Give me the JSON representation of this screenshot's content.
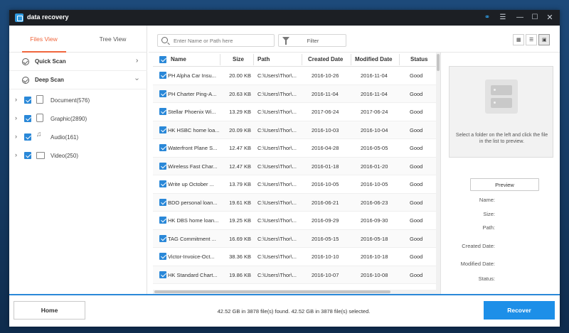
{
  "app": {
    "title": "data recovery"
  },
  "view_tabs": [
    {
      "label": "Files View"
    },
    {
      "label": "Tree View"
    }
  ],
  "scans": [
    {
      "label": "Quick Scan"
    },
    {
      "label": "Deep Scan"
    }
  ],
  "tree": [
    {
      "label": "Document(576)"
    },
    {
      "label": "Graphic(2890)"
    },
    {
      "label": "Audio(161)"
    },
    {
      "label": "Video(250)"
    }
  ],
  "search": {
    "placeholder": "Enter Name or Path here"
  },
  "filter": {
    "label": "Filter"
  },
  "columns": {
    "name": "Name",
    "size": "Size",
    "path": "Path",
    "created": "Created Date",
    "modified": "Modified Date",
    "status": "Status"
  },
  "rows": [
    {
      "name": "PH Alpha Car Insu...",
      "size": "20.00 KB",
      "path": "C:\\Users\\Thor\\...",
      "created": "2016-10-26",
      "modified": "2016-11-04",
      "status": "Good"
    },
    {
      "name": "PH Charter Ping-A...",
      "size": "20.63 KB",
      "path": "C:\\Users\\Thor\\...",
      "created": "2016-11-04",
      "modified": "2016-11-04",
      "status": "Good"
    },
    {
      "name": "Stellar Phoenix Wi...",
      "size": "13.29 KB",
      "path": "C:\\Users\\Thor\\...",
      "created": "2017-06-24",
      "modified": "2017-06-24",
      "status": "Good"
    },
    {
      "name": "HK HSBC home loa...",
      "size": "20.09 KB",
      "path": "C:\\Users\\Thor\\...",
      "created": "2016-10-03",
      "modified": "2016-10-04",
      "status": "Good"
    },
    {
      "name": "Waterfront Plane S...",
      "size": "12.47 KB",
      "path": "C:\\Users\\Thor\\...",
      "created": "2016-04-28",
      "modified": "2016-05-05",
      "status": "Good"
    },
    {
      "name": "Wireless Fast Char...",
      "size": "12.47 KB",
      "path": "C:\\Users\\Thor\\...",
      "created": "2016-01-18",
      "modified": "2016-01-20",
      "status": "Good"
    },
    {
      "name": "Write up October ...",
      "size": "13.79 KB",
      "path": "C:\\Users\\Thor\\...",
      "created": "2016-10-05",
      "modified": "2016-10-05",
      "status": "Good"
    },
    {
      "name": "BDO personal loan...",
      "size": "19.61 KB",
      "path": "C:\\Users\\Thor\\...",
      "created": "2016-06-21",
      "modified": "2016-06-23",
      "status": "Good"
    },
    {
      "name": "HK DBS home loan...",
      "size": "19.25 KB",
      "path": "C:\\Users\\Thor\\...",
      "created": "2016-09-29",
      "modified": "2016-09-30",
      "status": "Good"
    },
    {
      "name": "TAG Commitment ...",
      "size": "16.69 KB",
      "path": "C:\\Users\\Thor\\...",
      "created": "2016-05-15",
      "modified": "2016-05-18",
      "status": "Good"
    },
    {
      "name": "Victor-Invoice-Oct...",
      "size": "38.36 KB",
      "path": "C:\\Users\\Thor\\...",
      "created": "2016-10-10",
      "modified": "2016-10-18",
      "status": "Good"
    },
    {
      "name": "HK Standard Chart...",
      "size": "19.86 KB",
      "path": "C:\\Users\\Thor\\...",
      "created": "2016-10-07",
      "modified": "2016-10-08",
      "status": "Good"
    }
  ],
  "preview": {
    "hint": "Select a folder on the left and click the file in the list to preview.",
    "button": "Preview",
    "labels": {
      "name": "Name:",
      "size": "Size:",
      "path": "Path:",
      "created": "Created Date:",
      "modified": "Modified Date:",
      "status": "Status:"
    }
  },
  "footer": {
    "home": "Home",
    "status": "42.52 GB in 3878 file(s) found.   42.52 GB in 3878 file(s) selected.",
    "recover": "Recover"
  },
  "colors": {
    "accent": "#1d8fe8",
    "tab_active": "#f0663c",
    "titlebar": "#1c1f24"
  },
  "icons": {
    "titlebar": [
      "key-icon",
      "menu-icon",
      "minimize-icon",
      "maximize-icon",
      "close-icon"
    ]
  }
}
